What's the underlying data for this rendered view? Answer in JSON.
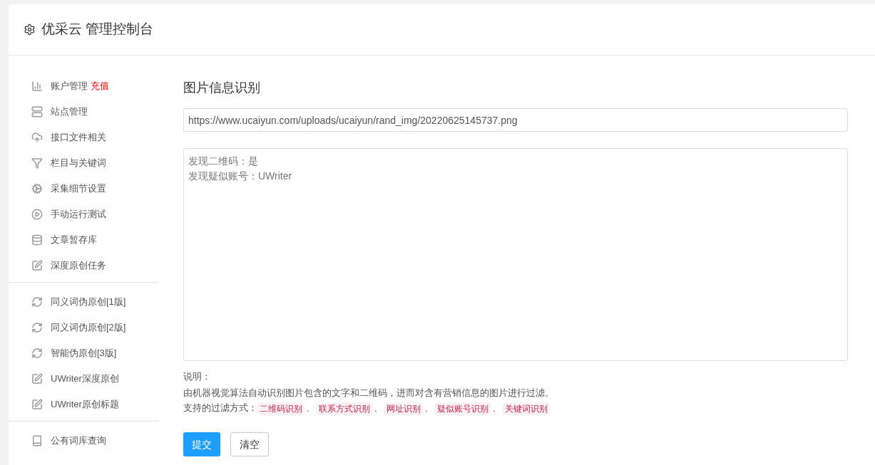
{
  "header": {
    "title": "优采云 管理控制台"
  },
  "sidebar": {
    "groups": [
      {
        "items": [
          {
            "kind": "bar-chart",
            "label": "账户管理",
            "badge": "充值"
          },
          {
            "kind": "server",
            "label": "站点管理"
          },
          {
            "kind": "cloud-upload",
            "label": "接口文件相关"
          },
          {
            "kind": "filter",
            "label": "栏目与关键词"
          },
          {
            "kind": "gears",
            "label": "采集细节设置"
          },
          {
            "kind": "play",
            "label": "手动运行测试"
          },
          {
            "kind": "database",
            "label": "文章暂存库"
          },
          {
            "kind": "edit",
            "label": "深度原创任务"
          }
        ]
      },
      {
        "items": [
          {
            "kind": "refresh",
            "label": "同义词伪原创[1版]"
          },
          {
            "kind": "refresh",
            "label": "同义词伪原创[2版]"
          },
          {
            "kind": "refresh",
            "label": "智能伪原创[3版]"
          },
          {
            "kind": "edit",
            "label": "UWriter深度原创"
          },
          {
            "kind": "edit",
            "label": "UWriter原创标题"
          }
        ]
      },
      {
        "items": [
          {
            "kind": "book",
            "label": "公有词库查询"
          }
        ]
      }
    ]
  },
  "main": {
    "title": "图片信息识别",
    "url_field": {
      "value": "https://www.ucaiyun.com/uploads/ucaiyun/rand_img/20220625145737.png"
    },
    "result_box": {
      "lines": [
        "发现二维码：是",
        "发现疑似账号：UWriter"
      ]
    },
    "note_label": "说明：",
    "note_text": "由机器视觉算法自动识别图片包含的文字和二维码，进而对含有营销信息的图片进行过滤。",
    "filters_label": "支持的过滤方式：",
    "filters": [
      "二维码识别",
      "联系方式识别",
      "网址识别",
      "疑似账号识别",
      "关键词识别"
    ],
    "separator": "、",
    "buttons": [
      {
        "label": "提交",
        "kind": "primary"
      },
      {
        "label": "清空",
        "kind": "default"
      }
    ]
  }
}
